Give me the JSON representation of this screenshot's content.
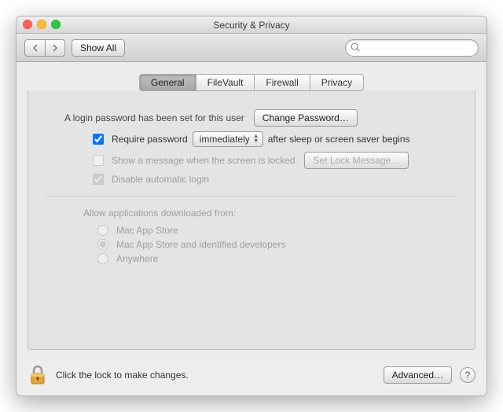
{
  "window": {
    "title": "Security & Privacy"
  },
  "toolbar": {
    "show_all": "Show All",
    "search_value": ""
  },
  "tabs": [
    {
      "label": "General",
      "active": true
    },
    {
      "label": "FileVault",
      "active": false
    },
    {
      "label": "Firewall",
      "active": false
    },
    {
      "label": "Privacy",
      "active": false
    }
  ],
  "general": {
    "login_password_text": "A login password has been set for this user",
    "change_password_btn": "Change Password…",
    "require_password_label_pre": "Require password",
    "require_password_dropdown": "immediately",
    "require_password_label_post": "after sleep or screen saver begins",
    "require_password_checked": true,
    "show_message_label": "Show a message when the screen is locked",
    "set_lock_message_btn": "Set Lock Message…",
    "disable_auto_login_label": "Disable automatic login",
    "gatekeeper_title": "Allow applications downloaded from:",
    "gatekeeper_options": [
      "Mac App Store",
      "Mac App Store and identified developers",
      "Anywhere"
    ],
    "gatekeeper_selected_index": 1
  },
  "footer": {
    "lock_text": "Click the lock to make changes.",
    "advanced_btn": "Advanced…"
  }
}
